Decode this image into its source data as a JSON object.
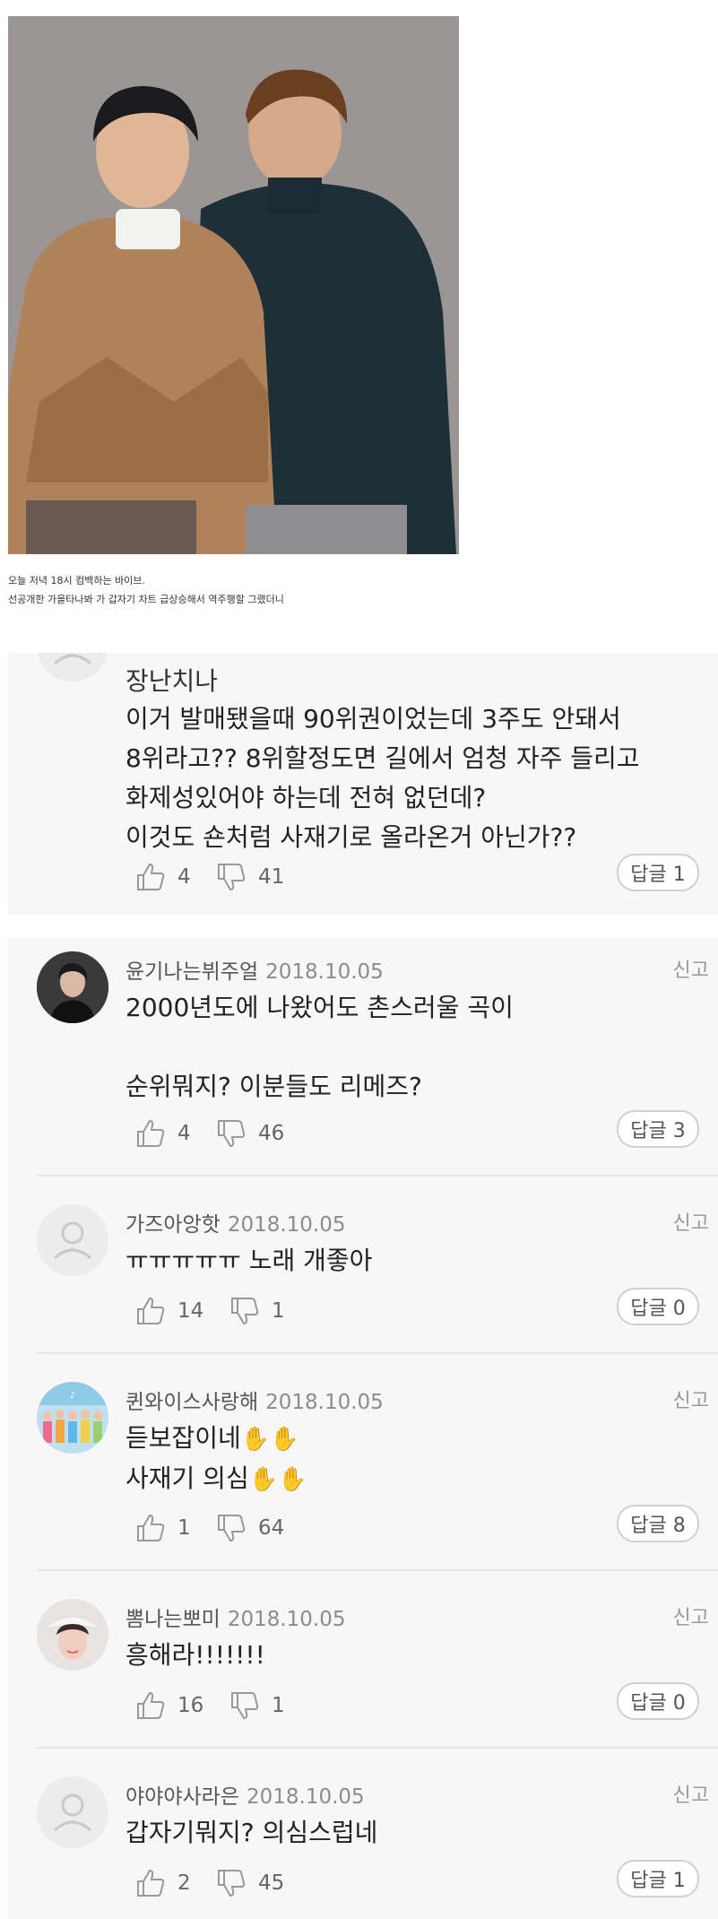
{
  "article": {
    "caption_line1": "오늘 저녁 18시 컴백하는 바이브.",
    "caption_line2": "선공개한 가을타나봐 가 갑자기 차트 급상승해서 역주행할 그랬더니"
  },
  "labels": {
    "report": "신고"
  },
  "comments": [
    {
      "nick": "장난치나",
      "date": "",
      "body": "이거 발매됐을때 90위권이었는데 3주도 안돼서\n8위라고?? 8위할정도면 길에서 엄청 자주 들리고\n화제성있어야 하는데 전혀 없던데?\n이것도 숀처럼 사재기로 올라온거 아닌가??",
      "likes": "4",
      "dislikes": "41",
      "reply": "답글 1"
    },
    {
      "nick": "윤기나는뷔주얼",
      "date": "2018.10.05",
      "body": "2000년도에 나왔어도 촌스러울 곡이\n\n순위뭐지? 이분들도 리메즈?",
      "likes": "4",
      "dislikes": "46",
      "reply": "답글 3"
    },
    {
      "nick": "가즈아앙핫",
      "date": "2018.10.05",
      "body": "ㅠㅠㅠㅠㅠ 노래 개좋아",
      "likes": "14",
      "dislikes": "1",
      "reply": "답글 0"
    },
    {
      "nick": "퀸와이스사랑해",
      "date": "2018.10.05",
      "body_line1": "듣보잡이네",
      "body_line2": "사재기 의심",
      "emoji": "✋✋",
      "likes": "1",
      "dislikes": "64",
      "reply": "답글 8"
    },
    {
      "nick": "뽐나는뽀미",
      "date": "2018.10.05",
      "body": "흥해라!!!!!!!",
      "likes": "16",
      "dislikes": "1",
      "reply": "답글 0"
    },
    {
      "nick": "야야야사라은",
      "date": "2018.10.05",
      "body": "갑자기뭐지? 의심스럽네",
      "likes": "2",
      "dislikes": "45",
      "reply": "답글 1"
    }
  ]
}
